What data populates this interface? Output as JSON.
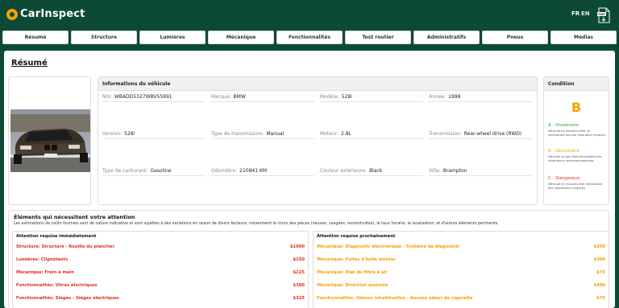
{
  "brand": {
    "name": "CarInspect"
  },
  "header": {
    "lang_fr": "FR",
    "lang_en": "EN"
  },
  "nav": [
    "Résumé",
    "Structure",
    "Lumières",
    "Mécanique",
    "Fonctionnalités",
    "Test routier",
    "Administratifs",
    "Pneus",
    "Médias"
  ],
  "page_title": "Résumé",
  "vehicle_info": {
    "title": "Informations du véhicule",
    "fields": [
      {
        "label": "NIV:",
        "value": "WBADD5327WBV55991"
      },
      {
        "label": "Marque:",
        "value": "BMW"
      },
      {
        "label": "Modèle:",
        "value": "528i"
      },
      {
        "label": "Année:",
        "value": "1998"
      },
      {
        "label": "Version:",
        "value": "528i"
      },
      {
        "label": "Type de transmission:",
        "value": "Manual"
      },
      {
        "label": "Moteur:",
        "value": "2.8L"
      },
      {
        "label": "Transmission:",
        "value": "Rear-wheel drive (RWD)"
      },
      {
        "label": "Type de carburant:",
        "value": "Gasoline"
      },
      {
        "label": "Odomètre:",
        "value": "210841 KM"
      },
      {
        "label": "Couleur extérieure:",
        "value": "Black"
      },
      {
        "label": "Ville:",
        "value": "Brampton"
      }
    ]
  },
  "condition": {
    "title": "Condition",
    "grade": "B",
    "levels": [
      {
        "title": "A : Showroom",
        "desc": "Véhicule en excellent état ne nécessitant aucune réparation majeure."
      },
      {
        "title": "B : Sécuritaire",
        "desc": "Véhicule en bon état nécessitant des réparations mineures/majeures."
      },
      {
        "title": "C : Dangereux",
        "desc": "Véhicule en mauvais état nécessitant des réparations majeures."
      }
    ]
  },
  "attention": {
    "title": "Éléments qui nécessitent votre attention",
    "subtitle": "Les estimations de coûts fournies sont de nature indicative et sont sujettes à des variations en raison de divers facteurs, notamment le choix des pièces (neuves, usagées, reconstruites), le taux horaire, la localisation, et d'autres éléments pertinents.",
    "immediate": {
      "title": "Attention requise immédiatement",
      "items": [
        {
          "label": "Structure: Structure - Rouille du plancher",
          "cost": "$1000"
        },
        {
          "label": "Lumières: Clignotants",
          "cost": "$150"
        },
        {
          "label": "Mécanique: Frein à main",
          "cost": "$225"
        },
        {
          "label": "Fonctionnalités: Vitres électriques",
          "cost": "$300"
        },
        {
          "label": "Fonctionnalités: Sièges - Sièges électriques",
          "cost": "$325"
        }
      ]
    },
    "soon": {
      "title": "Attention requise prochainement",
      "items": [
        {
          "label": "Mécanique: Diagnostic électronique - Système de diagnostic",
          "cost": "$200"
        },
        {
          "label": "Mécanique: Fuites d'huile moteur",
          "cost": "$300"
        },
        {
          "label": "Mécanique: État du filtre à air",
          "cost": "$75"
        },
        {
          "label": "Mécanique: Direction assistée",
          "cost": "$400"
        },
        {
          "label": "Fonctionnalités: Odeurs inhabituelles - Aucune odeur de cigarette",
          "cost": "$75"
        }
      ]
    }
  },
  "colors": {
    "brand_green": "#0c4a36",
    "accent_orange": "#f5a000",
    "danger_red": "#e52b20",
    "ok_green": "#2e9e3c"
  }
}
